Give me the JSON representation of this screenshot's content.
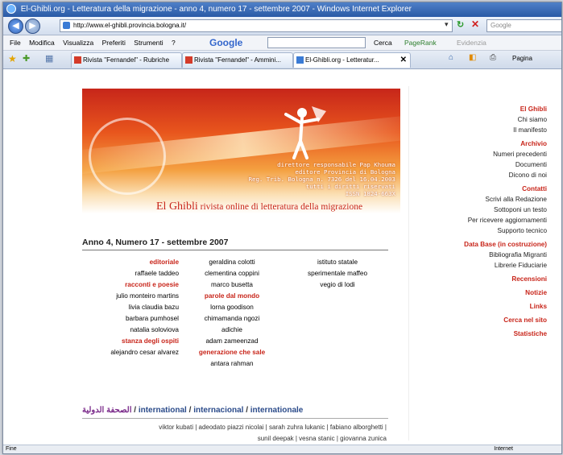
{
  "window": {
    "title": "El-Ghibli.org - Letteratura della migrazione - anno 4, numero 17 - settembre 2007 - Windows Internet Explorer"
  },
  "addressbar": {
    "url": "http://www.el-ghibli.provincia.bologna.it/",
    "search_placeholder": "Google"
  },
  "menubar": {
    "items": [
      "File",
      "Modifica",
      "Visualizza",
      "Preferiti",
      "Strumenti",
      "?"
    ],
    "google_label": "Google",
    "cerca_label": "Cerca",
    "pagerank_label": "PageRank",
    "evidenzia_label": "Evidenzia"
  },
  "tabs": [
    {
      "label": "Rivista \"Fernandel\" - Rubriche"
    },
    {
      "label": "Rivista \"Fernandel\" - Ammini..."
    },
    {
      "label": "El-Ghibli.org - Letteratur..."
    }
  ],
  "tools": {
    "pagina_label": "Pagina"
  },
  "banner": {
    "info_lines": [
      "direttore responsabile Pap Khouma",
      "editore Provincia di Bologna",
      "Reg. Trib. Bologna n. 7326 del 16.04.2003",
      "tutti i diritti riservati",
      "ISSN 1824-663X"
    ],
    "name": "El Ghibli",
    "tagline": " rivista online di letteratura della migrazione"
  },
  "issue": {
    "label": "Anno 4, Numero 17 - settembre 2007"
  },
  "columns": {
    "col1": [
      {
        "text": "editoriale",
        "section": true
      },
      {
        "text": "raffaele taddeo",
        "section": false
      },
      {
        "text": "racconti e poesie",
        "section": true
      },
      {
        "text": "julio monteiro martins",
        "section": false
      },
      {
        "text": "livia claudia bazu",
        "section": false
      },
      {
        "text": "barbara pumhosel",
        "section": false
      },
      {
        "text": "natalia soloviova",
        "section": false
      },
      {
        "text": "stanza degli ospiti",
        "section": true
      },
      {
        "text": "alejandro cesar alvarez",
        "section": false
      }
    ],
    "col2": [
      {
        "text": "geraldina colotti",
        "section": false
      },
      {
        "text": "clementina coppini",
        "section": false
      },
      {
        "text": "marco busetta",
        "section": false
      },
      {
        "text": "parole dal mondo",
        "section": true
      },
      {
        "text": "lorna goodison",
        "section": false
      },
      {
        "text": "chimamanda ngozi",
        "section": false
      },
      {
        "text": "adichie",
        "section": false
      },
      {
        "text": "adam zameenzad",
        "section": false
      },
      {
        "text": "generazione che sale",
        "section": true
      },
      {
        "text": "antara rahman",
        "section": false
      }
    ],
    "col3": [
      {
        "text": "istituto statale",
        "section": false
      },
      {
        "text": "sperimentale maffeo",
        "section": false
      },
      {
        "text": "vegio di lodi",
        "section": false
      }
    ]
  },
  "international": {
    "arabic": "الصحفة الدولية",
    "sep": " / ",
    "en": "international",
    "es": "internacional",
    "fr": "internationale",
    "authors_line1": "viktor kubati | adeodato piazzi nicolai | sarah zuhra lukanic | fabiano alborghetti |",
    "authors_line2": "sunil deepak | vesna stanic | giovanna zunica"
  },
  "sidebar": {
    "groups": [
      {
        "header": "El Ghibli",
        "items": [
          "Chi siamo",
          "Il manifesto"
        ]
      },
      {
        "header": "Archivio",
        "items": [
          "Numeri precedenti",
          "Documenti",
          "Dicono di noi"
        ]
      },
      {
        "header": "Contatti",
        "items": [
          "Scrivi alla Redazione",
          "Sottoponi un testo",
          "Per ricevere aggiornamenti",
          "Supporto tecnico"
        ]
      },
      {
        "header": "Data Base (in costruzione)",
        "items": [
          "Bibliografia Migranti",
          "Librerie Fiduciarie"
        ]
      },
      {
        "header": "Recensioni",
        "items": []
      },
      {
        "header": "Notizie",
        "items": []
      },
      {
        "header": "Links",
        "items": []
      },
      {
        "header": "Cerca nel sito",
        "items": []
      },
      {
        "header": "Statistiche",
        "items": []
      }
    ]
  },
  "status": {
    "text": "Fine",
    "zone": "Internet"
  }
}
